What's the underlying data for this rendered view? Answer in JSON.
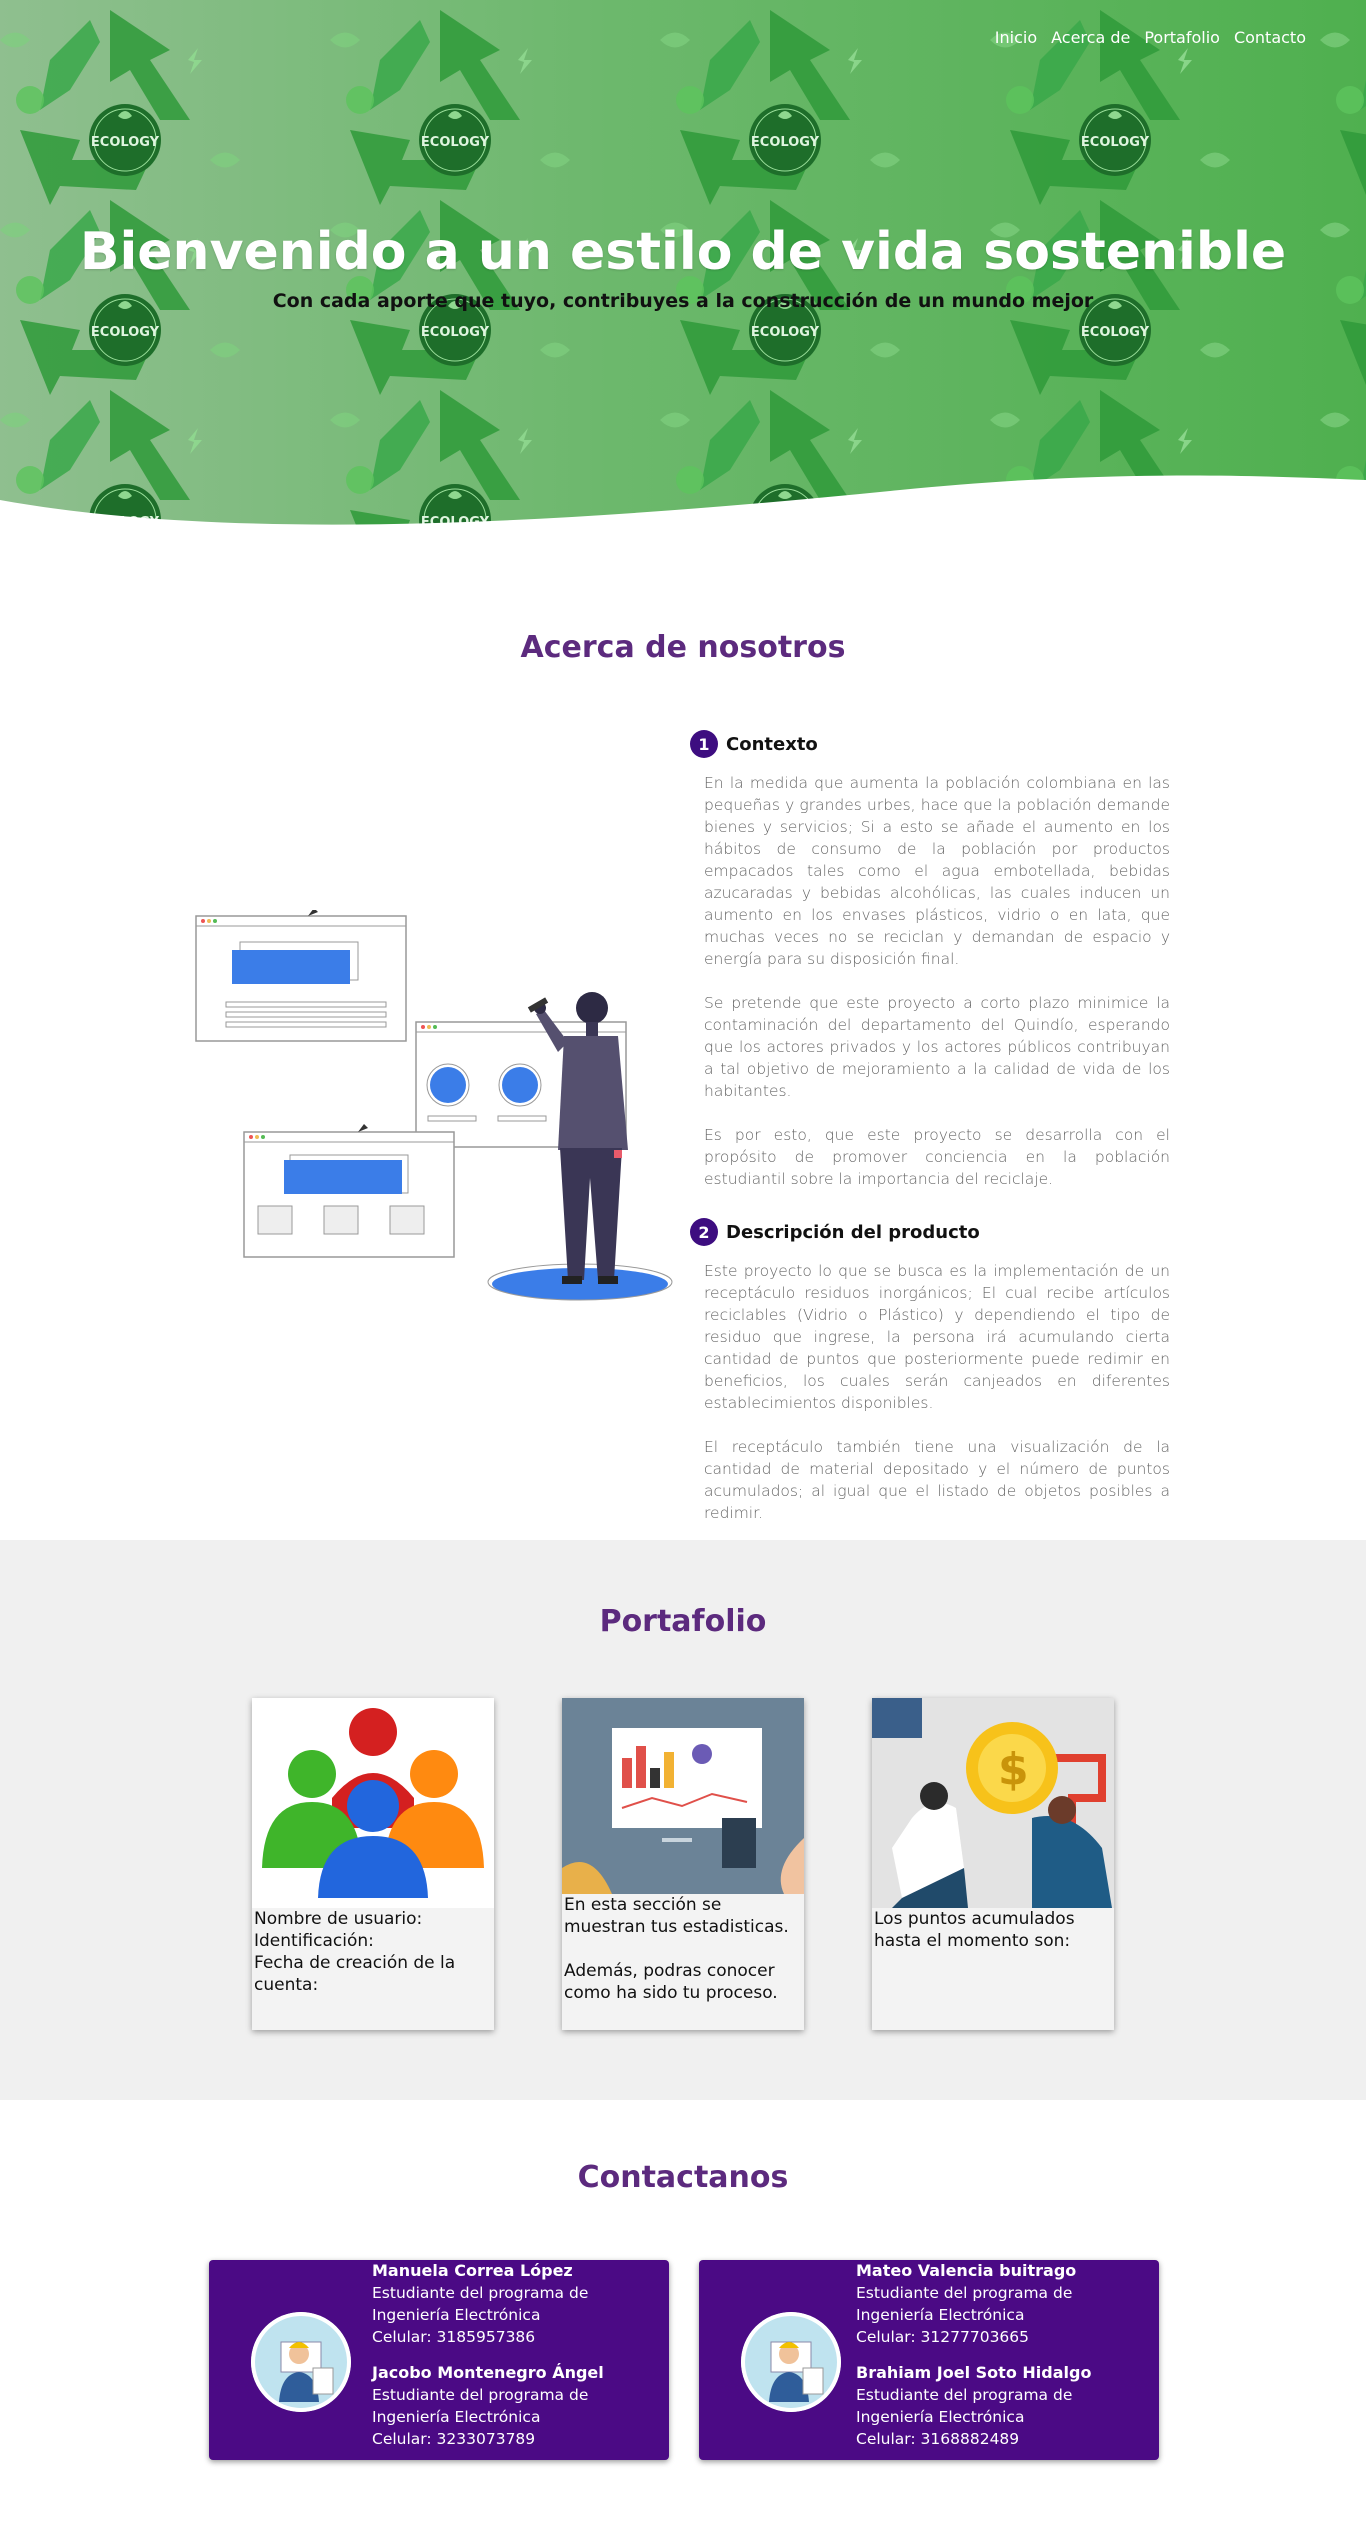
{
  "nav": {
    "items": [
      "Inicio",
      "Acerca de",
      "Portafolio",
      "Contacto"
    ]
  },
  "hero": {
    "title": "Bienvenido a un estilo de vida sostenible",
    "subtitle": "Con cada aporte que tuyo, contribuyes a la construcción de un mundo mejor",
    "pattern_label": "ECOLOGY"
  },
  "about": {
    "title": "Acerca de nosotros",
    "points": [
      {
        "number": "1",
        "title": "Contexto",
        "paragraphs": [
          "En la medida que aumenta la población colombiana en las pequeñas y grandes urbes, hace que la población demande bienes y servicios; Si a esto se añade el aumento en los hábitos de consumo de la población por productos empacados tales como el agua embotellada, bebidas azucaradas y bebidas alcohólicas, las cuales inducen un aumento en los envases plásticos, vidrio o en lata, que muchas veces no se reciclan y demandan de espacio y energía para su disposición final.",
          "Se pretende que este proyecto a corto plazo minimice la contaminación del departamento del Quindío, esperando que los actores privados y los actores públicos contribuyan a tal objetivo de mejoramiento a la calidad de vida de los habitantes.",
          "Es por esto, que este proyecto se desarrolla con el propósito de promover conciencia en la población estudiantil sobre la importancia del reciclaje."
        ]
      },
      {
        "number": "2",
        "title": "Descripción del producto",
        "paragraphs": [
          "Este proyecto lo que se busca es la implementación de un receptáculo residuos inorgánicos; El cual recibe artículos reciclables (Vidrio o Plástico) y dependiendo el tipo de residuo que ingrese, la persona irá acumulando cierta cantidad de puntos que posteriormente puede redimir en beneficios, los cuales serán canjeados en diferentes establecimientos disponibles.",
          "El receptáculo también tiene una visualización de la cantidad de material depositado y el número de puntos acumulados; al igual que el listado de objetos posibles a redimir."
        ]
      }
    ]
  },
  "portfolio": {
    "title": "Portafolio",
    "cards": [
      {
        "lines": [
          "Nombre de usuario:",
          "Identificación:",
          "Fecha de creación de la cuenta:"
        ]
      },
      {
        "lines": [
          "En esta sección se muestran tus estadisticas.",
          "",
          "Además, podras conocer como ha sido tu proceso."
        ]
      },
      {
        "lines": [
          "Los puntos acumulados hasta el momento son:"
        ]
      }
    ]
  },
  "contact": {
    "title": "Contactanos",
    "cards": [
      {
        "people": [
          {
            "name": "Manuela Correa López",
            "role": "Estudiante del programa de Ingeniería Electrónica",
            "phone": "Celular: 3185957386"
          },
          {
            "name": "Jacobo Montenegro Ángel",
            "role": "Estudiante del programa de Ingeniería Electrónica",
            "phone": "Celular: 3233073789"
          }
        ]
      },
      {
        "people": [
          {
            "name": "Mateo Valencia buitrago",
            "role": "Estudiante del programa de Ingeniería Electrónica",
            "phone": "Celular: 31277703665"
          },
          {
            "name": "Brahiam Joel Soto Hidalgo",
            "role": "Estudiante del programa de Ingeniería Electrónica",
            "phone": "Celular: 3168882489"
          }
        ]
      }
    ]
  },
  "colors": {
    "accent": "#5c2a7e",
    "badge": "#3d0d80",
    "contact_card": "#4b0a85",
    "hero_green": "#5bb35b"
  }
}
